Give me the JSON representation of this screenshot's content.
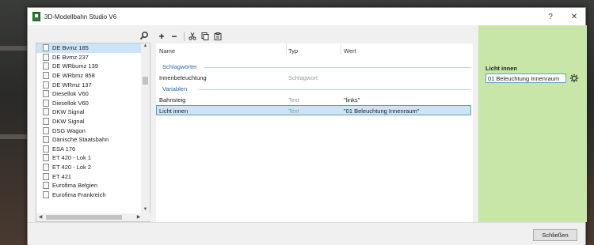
{
  "window": {
    "title": "3D-Modellbahn Studio V6",
    "help_label": "?",
    "close_label": "✕"
  },
  "left_panel": {
    "items": [
      "DE Bvmz 185",
      "DE Bvmz 237",
      "DE WRbumz 139",
      "DE WRbmz 858",
      "DE WRmz 137",
      "Diesellok V60",
      "Diesellok V60",
      "DKW Signal",
      "DKW Signal",
      "DSG Wagon",
      "Dänische Staatsbahn",
      "ESA 176",
      "ET 420 - Lok 1",
      "ET 420 - Lok 2",
      "ET 421",
      "Eurofima Belgien",
      "Eurofima Frankreich"
    ],
    "selected_index": 0
  },
  "grid": {
    "columns": {
      "name": "Name",
      "type": "Typ",
      "value": "Wert"
    },
    "groups": [
      {
        "label": "Schlagwörter",
        "rows": [
          {
            "name": "Innenbeleuchtung",
            "type": "Schlagwort",
            "value": ""
          }
        ]
      },
      {
        "label": "Variablen",
        "rows": [
          {
            "name": "Bahnsteig",
            "type": "Text",
            "value": "\"links\""
          },
          {
            "name": "Licht innen",
            "type": "Text",
            "value": "\"01 Beleuchtung Innenraum\""
          }
        ]
      }
    ]
  },
  "right_panel": {
    "label": "Licht innen",
    "value": "01 Beleuchtung Innenraum"
  },
  "footer": {
    "close_button": "Schließen"
  },
  "colors": {
    "accent_panel": "#c8e6a7",
    "selection": "#cce4f7",
    "group_text": "#2a6ab0"
  }
}
